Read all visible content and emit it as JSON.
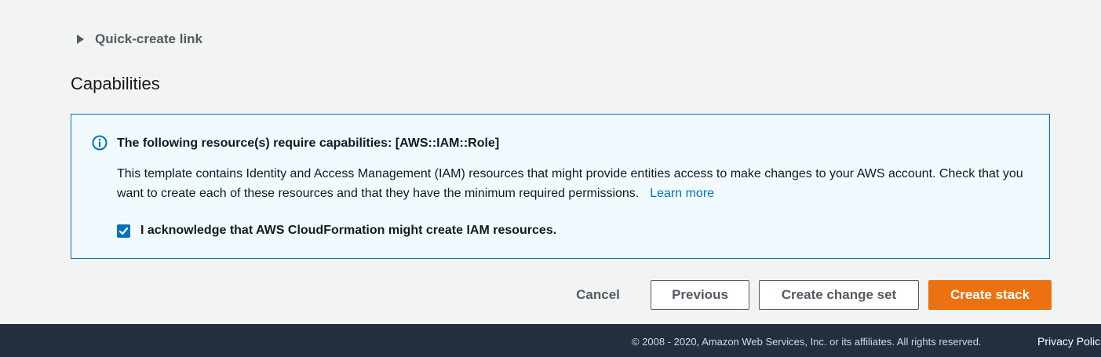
{
  "quick_create": {
    "label": "Quick-create link",
    "icon": "caret-right-icon"
  },
  "capabilities": {
    "heading": "Capabilities",
    "alert": {
      "icon": "info-icon",
      "title": "The following resource(s) require capabilities: [AWS::IAM::Role]",
      "body": "This template contains Identity and Access Management (IAM) resources that might provide entities access to make changes to your AWS account. Check that you want to create each of these resources and that they have the minimum required permissions.",
      "learn_more": "Learn more",
      "acknowledge_label": "I acknowledge that AWS CloudFormation might create IAM resources.",
      "acknowledge_checked": true
    }
  },
  "actions": {
    "cancel": "Cancel",
    "previous": "Previous",
    "create_change_set": "Create change set",
    "create_stack": "Create stack"
  },
  "footer": {
    "copyright": "© 2008 - 2020, Amazon Web Services, Inc. or its affiliates. All rights reserved.",
    "privacy": "Privacy Polic"
  },
  "colors": {
    "accent": "#0073bb",
    "primary_button": "#ec7211",
    "footer_bg": "#232f3e",
    "page_bg": "#f2f3f3",
    "alert_bg": "#f1faff"
  }
}
